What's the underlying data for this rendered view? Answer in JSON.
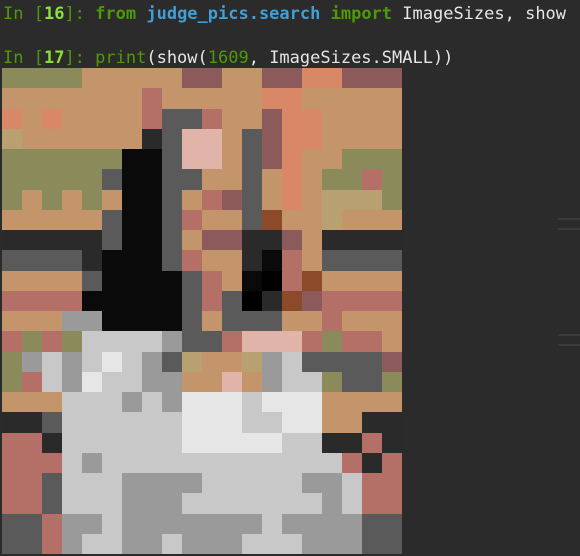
{
  "cells": [
    {
      "prompt_label": "In [",
      "number": "16",
      "prompt_close": "]: ",
      "code": {
        "kw1": "from",
        "module": "judge_pics.search",
        "kw2": "import",
        "rest": " ImageSizes, show"
      }
    },
    {
      "prompt_label": "In [",
      "number": "17",
      "prompt_close": "]: ",
      "code": {
        "func": "print",
        "open": "(show(",
        "arg_num": "1609",
        "rest": ", ImageSizes.SMALL))"
      }
    }
  ],
  "output_image": {
    "cols": 20,
    "rows": 24,
    "palette": {
      "a": "#8a8a5a",
      "b": "#c4946a",
      "c": "#b47066",
      "d": "#8c5a5a",
      "e": "#d88866",
      "f": "#5a5a5a",
      "g": "#2a2a2a",
      "h": "#0a0a0a",
      "i": "#c8c8c8",
      "j": "#e6e6e6",
      "k": "#9a9a9a",
      "l": "#7a7a7a",
      "m": "#e0b4a8",
      "n": "#b8a070",
      "o": "#8c4a2a",
      "p": "#000000"
    },
    "pixels": [
      "aaaabbbbbddbbddeeddd",
      "bbbbbbbcbbbbbeebbbbb",
      "ebebbbbcffcbbdeebbbb",
      "nbbbbbbgfmmbfdeebbbb",
      "aaaaaahhfmmbfdebbaaa",
      "aaaaafhhffbbfbebaaca",
      "abababhhfbcdfbebnnna",
      "bbbbbfhhfcbbfobbnbbb",
      "gggggfhhfbddggdbgggg",
      "ffffghhhfcbbghcbffff",
      "bbbbfhhhhfcbhpcobbbb",
      "cccchhhhhfcfpgodcccc",
      "bbbkkhhhhfbfffbbcbbb",
      "cacaiiiikffcmmmcaccb",
      "akikijikfnbbnkiffffd",
      "acikjiikkbbmbkiiaffa",
      "bbbiiikikjjjijjjbbbb",
      "ggfiiiiiijjjiijjbbgg",
      "ccgiiiiiijjjjjiiggcg",
      "cccikiiiiiiiiiiiicgc",
      "ccfiiikkkkiiiiikkicc",
      "ccfiiikkkiiiiiiikicc",
      "ffckkikkkkkkkikkkkff",
      "ffckiikkikkkiiikkkff"
    ]
  }
}
